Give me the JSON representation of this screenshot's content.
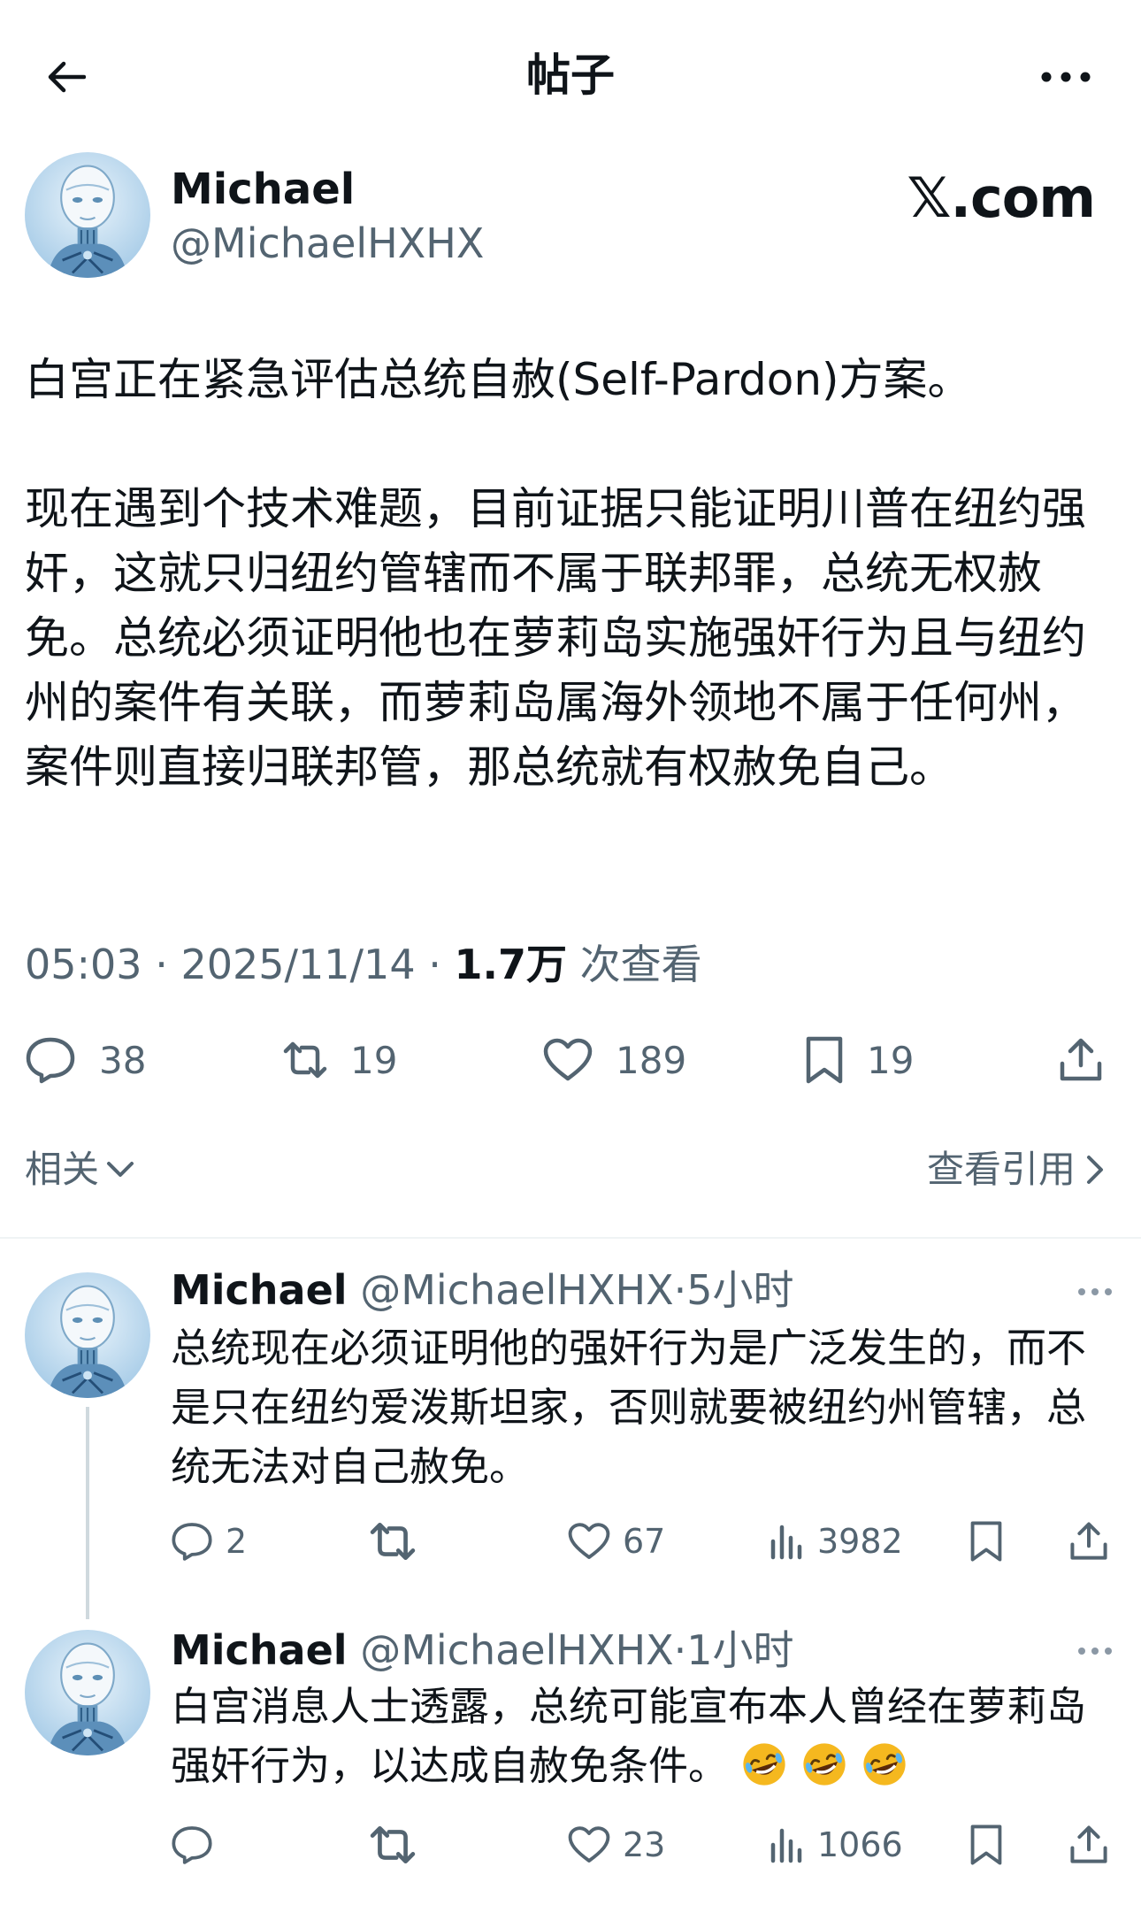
{
  "header": {
    "title": "帖子",
    "back_icon": "arrow-left-icon",
    "more_icon": "more-horizontal-icon"
  },
  "post": {
    "author_name": "Michael",
    "author_handle": "@MichaelHXHX",
    "watermark": "𝕏.com",
    "paragraphs": [
      "白宫正在紧急评估总统自赦(Self-Pardon)方案。",
      "现在遇到个技术难题，目前证据只能证明川普在纽约强奸，这就只归纽约管辖而不属于联邦罪，总统无权赦免。总统必须证明他也在萝莉岛实施强奸行为且与纽约州的案件有关联，而萝莉岛属海外领地不属于任何州，案件则直接归联邦管，那总统就有权赦免自己。"
    ],
    "time": "05:03",
    "date": "2025/11/14",
    "views_count": "1.7万",
    "views_label": "次查看",
    "stats": {
      "replies": "38",
      "reposts": "19",
      "likes": "189",
      "bookmarks": "19"
    }
  },
  "related": {
    "label": "相关",
    "quotes_label": "查看引用"
  },
  "replies": [
    {
      "author_name": "Michael",
      "author_handle": "@MichaelHXHX",
      "separator": "·",
      "time": "5小时",
      "text": "总统现在必须证明他的强奸行为是广泛发生的，而不是只在纽约爱泼斯坦家，否则就要被纽约州管辖，总统无法对自己赦免。",
      "replies": "2",
      "likes": "67",
      "views": "3982"
    },
    {
      "author_name": "Michael",
      "author_handle": "@MichaelHXHX",
      "separator": "·",
      "time": "1小时",
      "text": "白宫消息人士透露，总统可能宣布本人曾经在萝莉岛强奸行为，以达成自赦免条件。",
      "emojis": [
        "rolling-on-floor-laughing",
        "rolling-on-floor-laughing",
        "rolling-on-floor-laughing"
      ],
      "likes": "23",
      "views": "1066"
    }
  ],
  "colors": {
    "text": "#0f1419",
    "secondary": "#536471",
    "divider": "#eff3f4",
    "emoji": "#f5b81f"
  }
}
